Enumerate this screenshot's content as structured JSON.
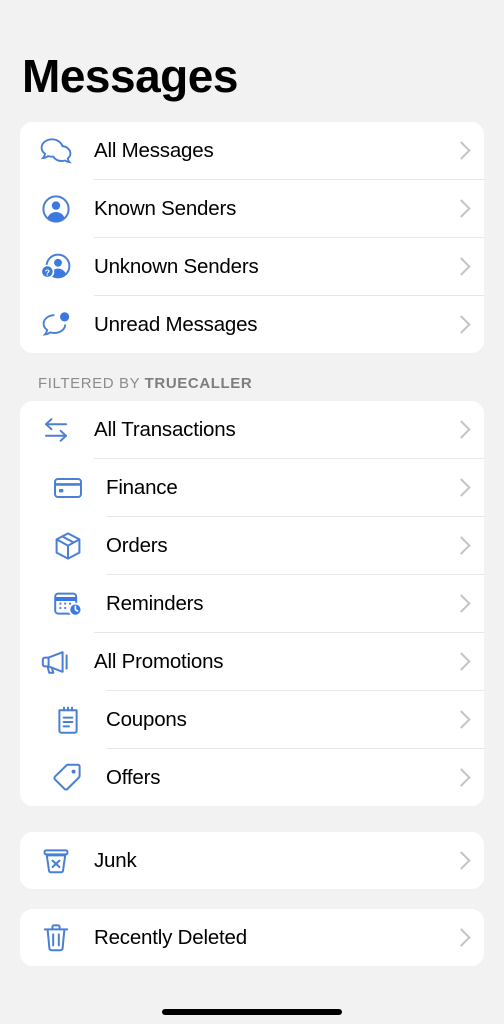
{
  "header": {
    "title": "Messages"
  },
  "colors": {
    "icon_blue": "#4a7fd6",
    "accent_blue": "#3b78e0",
    "background": "#f2f2f2",
    "card": "#ffffff",
    "chevron": "#c4c4c6"
  },
  "messages_card": {
    "items": [
      {
        "label": "All Messages",
        "icon": "two-speech-bubbles-icon"
      },
      {
        "label": "Known Senders",
        "icon": "person-circle-icon"
      },
      {
        "label": "Unknown Senders",
        "icon": "person-question-icon"
      },
      {
        "label": "Unread Messages",
        "icon": "speech-bubble-badge-icon"
      }
    ]
  },
  "filtered_section": {
    "header_prefix": "FILTERED BY ",
    "header_brand": "TRUECALLER",
    "items": [
      {
        "label": "All Transactions",
        "icon": "transfer-arrows-icon",
        "sub": false
      },
      {
        "label": "Finance",
        "icon": "credit-card-icon",
        "sub": true
      },
      {
        "label": "Orders",
        "icon": "package-box-icon",
        "sub": true
      },
      {
        "label": "Reminders",
        "icon": "calendar-clock-icon",
        "sub": true
      },
      {
        "label": "All Promotions",
        "icon": "megaphone-icon",
        "sub": false
      },
      {
        "label": "Coupons",
        "icon": "clipboard-icon",
        "sub": true
      },
      {
        "label": "Offers",
        "icon": "price-tag-icon",
        "sub": true
      }
    ]
  },
  "junk_card": {
    "label": "Junk",
    "icon": "trash-x-icon"
  },
  "deleted_card": {
    "label": "Recently Deleted",
    "icon": "trash-can-icon"
  },
  "home_indicator": {
    "name": "home-indicator"
  }
}
